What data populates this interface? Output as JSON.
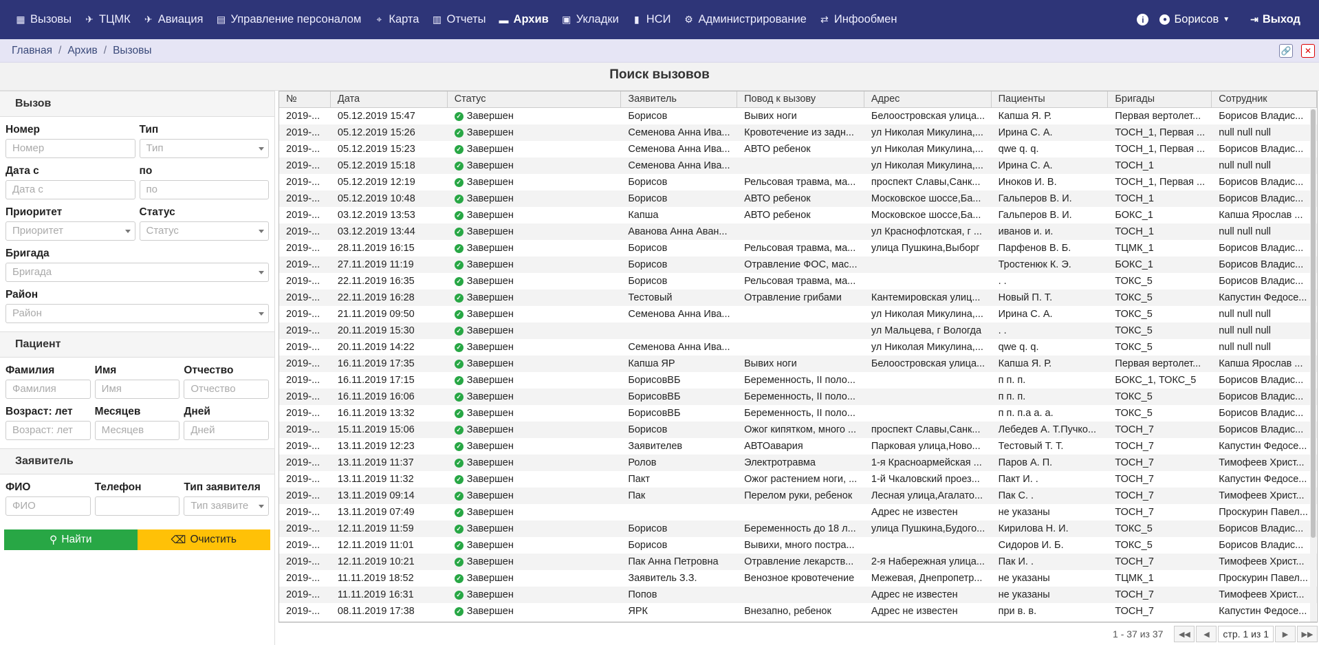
{
  "nav": {
    "items": [
      {
        "label": "Вызовы",
        "icon": "grid-icon"
      },
      {
        "label": "ТЦМК",
        "icon": "tcmk-icon"
      },
      {
        "label": "Авиация",
        "icon": "helicopter-icon"
      },
      {
        "label": "Управление персоналом",
        "icon": "calendar-icon"
      },
      {
        "label": "Карта",
        "icon": "map-icon"
      },
      {
        "label": "Отчеты",
        "icon": "report-icon"
      },
      {
        "label": "Архив",
        "icon": "archive-icon"
      },
      {
        "label": "Укладки",
        "icon": "briefcase-icon"
      },
      {
        "label": "НСИ",
        "icon": "book-icon"
      },
      {
        "label": "Администрирование",
        "icon": "gears-icon"
      },
      {
        "label": "Инфообмен",
        "icon": "exchange-icon"
      }
    ],
    "user": "Борисов",
    "logout": "Выход"
  },
  "breadcrumb": {
    "home": "Главная",
    "archive": "Архив",
    "current": "Вызовы"
  },
  "title": "Поиск вызовов",
  "filter": {
    "call_section": "Вызов",
    "number_label": "Номер",
    "number_ph": "Номер",
    "type_label": "Тип",
    "type_ph": "Тип",
    "date_from_label": "Дата с",
    "date_from_ph": "Дата с",
    "date_to_label": "по",
    "date_to_ph": "по",
    "priority_label": "Приоритет",
    "priority_ph": "Приоритет",
    "status_label": "Статус",
    "status_ph": "Статус",
    "brigade_label": "Бригада",
    "brigade_ph": "Бригада",
    "district_label": "Район",
    "district_ph": "Район",
    "patient_section": "Пациент",
    "surname_label": "Фамилия",
    "surname_ph": "Фамилия",
    "name_label": "Имя",
    "name_ph": "Имя",
    "patronymic_label": "Отчество",
    "patronymic_ph": "Отчество",
    "age_label": "Возраст: лет",
    "age_ph": "Возраст: лет",
    "months_label": "Месяцев",
    "months_ph": "Месяцев",
    "days_label": "Дней",
    "days_ph": "Дней",
    "caller_section": "Заявитель",
    "fio_label": "ФИО",
    "fio_ph": "ФИО",
    "phone_label": "Телефон",
    "caller_type_label": "Тип заявителя",
    "caller_type_ph": "Тип заявите",
    "find_button": "Найти",
    "clear_button": "Очистить"
  },
  "table": {
    "columns": [
      "№",
      "Дата",
      "Статус",
      "Заявитель",
      "Повод к вызову",
      "Адрес",
      "Пациенты",
      "Бригады",
      "Сотрудник"
    ],
    "status_color": "#28a745",
    "rows": [
      [
        "2019-...",
        "05.12.2019 15:47",
        "Завершен",
        "Борисов",
        "Вывих ноги",
        "Белоостровская улица...",
        "Капша Я. Р.",
        "Первая вертолет...",
        "Борисов Владис..."
      ],
      [
        "2019-...",
        "05.12.2019 15:26",
        "Завершен",
        "Семенова Анна Ива...",
        "Кровотечение из задн...",
        "ул Николая Микулина,...",
        "Ирина С. А.",
        "ТОСН_1, Первая ...",
        "null null null"
      ],
      [
        "2019-...",
        "05.12.2019 15:23",
        "Завершен",
        "Семенова Анна Ива...",
        "АВТО ребенок",
        "ул Николая Микулина,...",
        "qwe q. q.",
        "ТОСН_1, Первая ...",
        "Борисов Владис..."
      ],
      [
        "2019-...",
        "05.12.2019 15:18",
        "Завершен",
        "Семенова Анна Ива...",
        "",
        "ул Николая Микулина,...",
        "Ирина С. А.",
        "ТОСН_1",
        "null null null"
      ],
      [
        "2019-...",
        "05.12.2019 12:19",
        "Завершен",
        "Борисов",
        "Рельсовая травма, ма...",
        "проспект Славы,Санк...",
        "Иноков И. В.",
        "ТОСН_1, Первая ...",
        "Борисов Владис..."
      ],
      [
        "2019-...",
        "05.12.2019 10:48",
        "Завершен",
        "Борисов",
        "АВТО ребенок",
        "Московское шоссе,Ба...",
        "Гальперов В. И.",
        "ТОСН_1",
        "Борисов Владис..."
      ],
      [
        "2019-...",
        "03.12.2019 13:53",
        "Завершен",
        "Капша",
        "АВТО ребенок",
        "Московское шоссе,Ба...",
        "Гальперов В. И.",
        "БОКС_1",
        "Капша Ярослав ..."
      ],
      [
        "2019-...",
        "03.12.2019 13:44",
        "Завершен",
        "Аванова Анна Аван...",
        "",
        "ул Краснофлотская, г ...",
        "иванов и. и.",
        "ТОСН_1",
        "null null null"
      ],
      [
        "2019-...",
        "28.11.2019 16:15",
        "Завершен",
        "Борисов",
        "Рельсовая травма, ма...",
        "улица Пушкина,Выборг",
        "Парфенов В. Б.",
        "ТЦМК_1",
        "Борисов Владис..."
      ],
      [
        "2019-...",
        "27.11.2019 11:19",
        "Завершен",
        "Борисов",
        "Отравление ФОС, мас...",
        "",
        "Тростенюк К. Э.",
        "БОКС_1",
        "Борисов Владис..."
      ],
      [
        "2019-...",
        "22.11.2019 16:35",
        "Завершен",
        "Борисов",
        "Рельсовая травма, ма...",
        "",
        ". .",
        "ТОКС_5",
        "Борисов Владис..."
      ],
      [
        "2019-...",
        "22.11.2019 16:28",
        "Завершен",
        "Тестовый",
        "Отравление грибами",
        "Кантемировская улиц...",
        "Новый П. Т.",
        "ТОКС_5",
        "Капустин Федосе..."
      ],
      [
        "2019-...",
        "21.11.2019 09:50",
        "Завершен",
        "Семенова Анна Ива...",
        "",
        "ул Николая Микулина,...",
        "Ирина С. А.",
        "ТОКС_5",
        "null null null"
      ],
      [
        "2019-...",
        "20.11.2019 15:30",
        "Завершен",
        "",
        "",
        "ул Мальцева, г Вологда",
        ". .",
        "ТОКС_5",
        "null null null"
      ],
      [
        "2019-...",
        "20.11.2019 14:22",
        "Завершен",
        "Семенова Анна Ива...",
        "",
        "ул Николая Микулина,...",
        "qwe q. q.",
        "ТОКС_5",
        "null null null"
      ],
      [
        "2019-...",
        "16.11.2019 17:35",
        "Завершен",
        "Капша ЯР",
        "Вывих ноги",
        "Белоостровская улица...",
        "Капша Я. Р.",
        "Первая вертолет...",
        "Капша Ярослав ..."
      ],
      [
        "2019-...",
        "16.11.2019 17:15",
        "Завершен",
        "БорисовВБ",
        "Беременность, II поло...",
        "",
        "п п. п.",
        "БОКС_1, ТОКС_5",
        "Борисов Владис..."
      ],
      [
        "2019-...",
        "16.11.2019 16:06",
        "Завершен",
        "БорисовВБ",
        "Беременность, II поло...",
        "",
        "п п. п.",
        "ТОКС_5",
        "Борисов Владис..."
      ],
      [
        "2019-...",
        "16.11.2019 13:32",
        "Завершен",
        "БорисовВБ",
        "Беременность, II поло...",
        "",
        "п п. п.а а. а.",
        "ТОКС_5",
        "Борисов Владис..."
      ],
      [
        "2019-...",
        "15.11.2019 15:06",
        "Завершен",
        "Борисов",
        "Ожог кипятком, много ...",
        "проспект Славы,Санк...",
        "Лебедев А. Т.Пучко...",
        "ТОСН_7",
        "Борисов Владис..."
      ],
      [
        "2019-...",
        "13.11.2019 12:23",
        "Завершен",
        "Заявителев",
        "АВТОавария",
        "Парковая улица,Ново...",
        "Тестовый Т. Т.",
        "ТОСН_7",
        "Капустин Федосе..."
      ],
      [
        "2019-...",
        "13.11.2019 11:37",
        "Завершен",
        "Ролов",
        "Электротравма",
        "1-я Красноармейская ...",
        "Паров А. П.",
        "ТОСН_7",
        "Тимофеев Христ..."
      ],
      [
        "2019-...",
        "13.11.2019 11:32",
        "Завершен",
        "Пакт",
        "Ожог растением ноги, ...",
        "1-й Чкаловский проез...",
        "Пакт И. .",
        "ТОСН_7",
        "Капустин Федосе..."
      ],
      [
        "2019-...",
        "13.11.2019 09:14",
        "Завершен",
        "Пак",
        "Перелом руки, ребенок",
        "Лесная улица,Агалато...",
        "Пак С. .",
        "ТОСН_7",
        "Тимофеев Христ..."
      ],
      [
        "2019-...",
        "13.11.2019 07:49",
        "Завершен",
        "",
        "",
        "Адрес не известен",
        "не указаны",
        "ТОСН_7",
        "Проскурин Павел..."
      ],
      [
        "2019-...",
        "12.11.2019 11:59",
        "Завершен",
        "Борисов",
        "Беременность до 18 л...",
        "улица Пушкина,Будого...",
        "Кирилова Н. И.",
        "ТОКС_5",
        "Борисов Владис..."
      ],
      [
        "2019-...",
        "12.11.2019 11:01",
        "Завершен",
        "Борисов",
        "Вывихи, много постра...",
        "",
        "Сидоров И. Б.",
        "ТОКС_5",
        "Борисов Владис..."
      ],
      [
        "2019-...",
        "12.11.2019 10:21",
        "Завершен",
        "Пак Анна Петровна",
        "Отравление лекарств...",
        "2-я Набережная улица...",
        "Пак И. .",
        "ТОСН_7",
        "Тимофеев Христ..."
      ],
      [
        "2019-...",
        "11.11.2019 18:52",
        "Завершен",
        "Заявитель З.З.",
        "Венозное кровотечение",
        "Межевая, Днепропетр...",
        "не указаны",
        "ТЦМК_1",
        "Проскурин Павел..."
      ],
      [
        "2019-...",
        "11.11.2019 16:31",
        "Завершен",
        "Попов",
        "",
        "Адрес не известен",
        "не указаны",
        "ТОСН_7",
        "Тимофеев Христ..."
      ],
      [
        "2019-...",
        "08.11.2019 17:38",
        "Завершен",
        "ЯРК",
        "Внезапно, ребенок",
        "Адрес не известен",
        "при в. в.",
        "ТОСН_7",
        "Капустин Федосе..."
      ]
    ]
  },
  "pager": {
    "count": "1 - 37 из 37",
    "page": "стр. 1 из 1"
  },
  "colors": {
    "navbar": "#2e3578",
    "find": "#28a745",
    "clear": "#ffc107"
  }
}
